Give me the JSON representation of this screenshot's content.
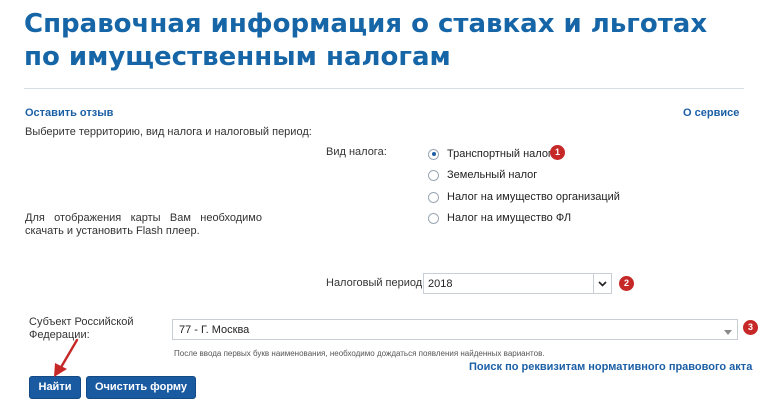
{
  "page": {
    "title": "Справочная информация о ставках и льготах по имущественным налогам"
  },
  "links": {
    "feedback": "Оставить отзыв",
    "about": "О сервисе",
    "search_by_requisites": "Поиск по реквизитам нормативного правового акта"
  },
  "form": {
    "instruction": "Выберите территорию, вид налога и налоговый период:",
    "flash_notice": "Для отображения карты Вам необходимо скачать и установить Flash плеер.",
    "tax_type_label": "Вид налога:",
    "tax_types": [
      {
        "label": "Транспортный налог",
        "checked": true
      },
      {
        "label": "Земельный налог",
        "checked": false
      },
      {
        "label": "Налог на имущество организаций",
        "checked": false
      },
      {
        "label": "Налог на имущество ФЛ",
        "checked": false
      }
    ],
    "period_label": "Налоговый период:",
    "period_value": "2018",
    "subject_label": "Субъект Российской Федерации:",
    "subject_value": "77 - Г. Москва",
    "subject_hint": "После ввода первых букв наименования, необходимо дождаться появления найденных вариантов.",
    "submit_label": "Найти",
    "clear_label": "Очистить форму"
  },
  "annotations": {
    "badge_1": "1",
    "badge_2": "2",
    "badge_3": "3",
    "accent_color": "#c62828"
  }
}
